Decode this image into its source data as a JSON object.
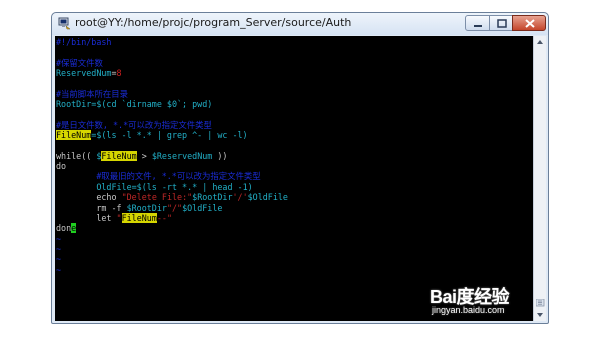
{
  "window": {
    "title": "root@YY:/home/projc/program_Server/source/Auth"
  },
  "editor": {
    "lines": [
      [
        {
          "t": "#!/bin/bash",
          "c": "comment"
        }
      ],
      [
        {
          "t": "",
          "c": "plain"
        }
      ],
      [
        {
          "t": "#保留文件数",
          "c": "comment"
        }
      ],
      [
        {
          "t": "ReservedNum",
          "c": "var"
        },
        {
          "t": "=",
          "c": "plain"
        },
        {
          "t": "8",
          "c": "num"
        }
      ],
      [
        {
          "t": "",
          "c": "plain"
        }
      ],
      [
        {
          "t": "#当前脚本所在目录",
          "c": "comment"
        }
      ],
      [
        {
          "t": "RootDir",
          "c": "var"
        },
        {
          "t": "=$(cd `dirname $0`; pwd)",
          "c": "var"
        }
      ],
      [
        {
          "t": "",
          "c": "plain"
        }
      ],
      [
        {
          "t": "#是日文件数, *.*可以改为指定文件类型",
          "c": "comment"
        }
      ],
      [
        {
          "t": "FileNum",
          "c": "hl"
        },
        {
          "t": "=$(ls -l *.* | grep ^- | wc -l)",
          "c": "var"
        }
      ],
      [
        {
          "t": "",
          "c": "plain"
        }
      ],
      [
        {
          "t": "while(( ",
          "c": "plain"
        },
        {
          "t": "$",
          "c": "var"
        },
        {
          "t": "FileNum",
          "c": "hl"
        },
        {
          "t": " > ",
          "c": "plain"
        },
        {
          "t": "$ReservedNum",
          "c": "var"
        },
        {
          "t": " ))",
          "c": "plain"
        }
      ],
      [
        {
          "t": "do",
          "c": "plain"
        }
      ],
      [
        {
          "t": "        #取最旧的文件, *.*可以改为指定文件类型",
          "c": "comment"
        }
      ],
      [
        {
          "t": "        OldFile",
          "c": "var"
        },
        {
          "t": "=$(ls -rt *.* | head -1)",
          "c": "var"
        }
      ],
      [
        {
          "t": "        echo ",
          "c": "plain"
        },
        {
          "t": "\"Delete File:\"",
          "c": "str"
        },
        {
          "t": "$RootDir",
          "c": "var"
        },
        {
          "t": "'/'",
          "c": "str"
        },
        {
          "t": "$OldFile",
          "c": "var"
        }
      ],
      [
        {
          "t": "        rm -f ",
          "c": "plain"
        },
        {
          "t": "$RootDir",
          "c": "var"
        },
        {
          "t": "\"/\"",
          "c": "str"
        },
        {
          "t": "$OldFile",
          "c": "var"
        }
      ],
      [
        {
          "t": "        let ",
          "c": "plain"
        },
        {
          "t": "\"",
          "c": "str"
        },
        {
          "t": "FileNum",
          "c": "hl"
        },
        {
          "t": "--\"",
          "c": "str"
        }
      ],
      [
        {
          "t": "don",
          "c": "plain"
        },
        {
          "t": "e",
          "c": "cursor"
        }
      ],
      [
        {
          "t": "~",
          "c": "tilde"
        }
      ],
      [
        {
          "t": "~",
          "c": "tilde"
        }
      ],
      [
        {
          "t": "~",
          "c": "tilde"
        }
      ],
      [
        {
          "t": "~",
          "c": "tilde"
        }
      ]
    ]
  },
  "watermark": {
    "logo_text": "Bai度经验",
    "url": "jingyan.baidu.com"
  }
}
